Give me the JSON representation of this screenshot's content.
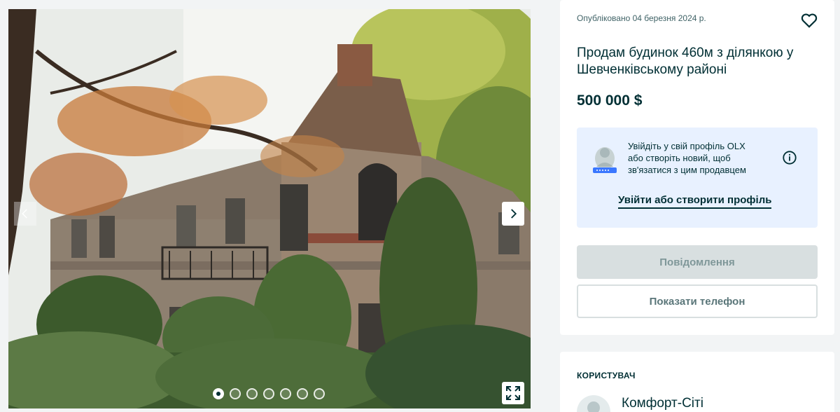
{
  "gallery": {
    "photo_count": 7,
    "active_index": 0
  },
  "ad": {
    "published": "Опубліковано 04 березня 2024 р.",
    "title": "Продам будинок 460м з ділянкою у Шевченківському районі",
    "price": "500 000 $"
  },
  "login_prompt": {
    "text": "Увійдіть у свій профіль OLX або створіть новий, щоб зв'язатися з цим продавцем",
    "link_label": "Увійти або створити профіль"
  },
  "actions": {
    "message_label": "Повідомлення",
    "phone_label": "Показати телефон"
  },
  "user": {
    "heading": "КОРИСТУВАЧ",
    "name": "Комфорт-Сіті"
  },
  "icons": {
    "prev": "chevron-left-icon",
    "next": "chevron-right-icon",
    "expand": "expand-icon",
    "favorite": "heart-icon",
    "info": "info-icon"
  },
  "colors": {
    "brand_dark": "#002f34",
    "login_box_bg": "#e8f1ff",
    "disabled_button": "#d8dfe0",
    "page_bg": "#f2f4f5"
  }
}
